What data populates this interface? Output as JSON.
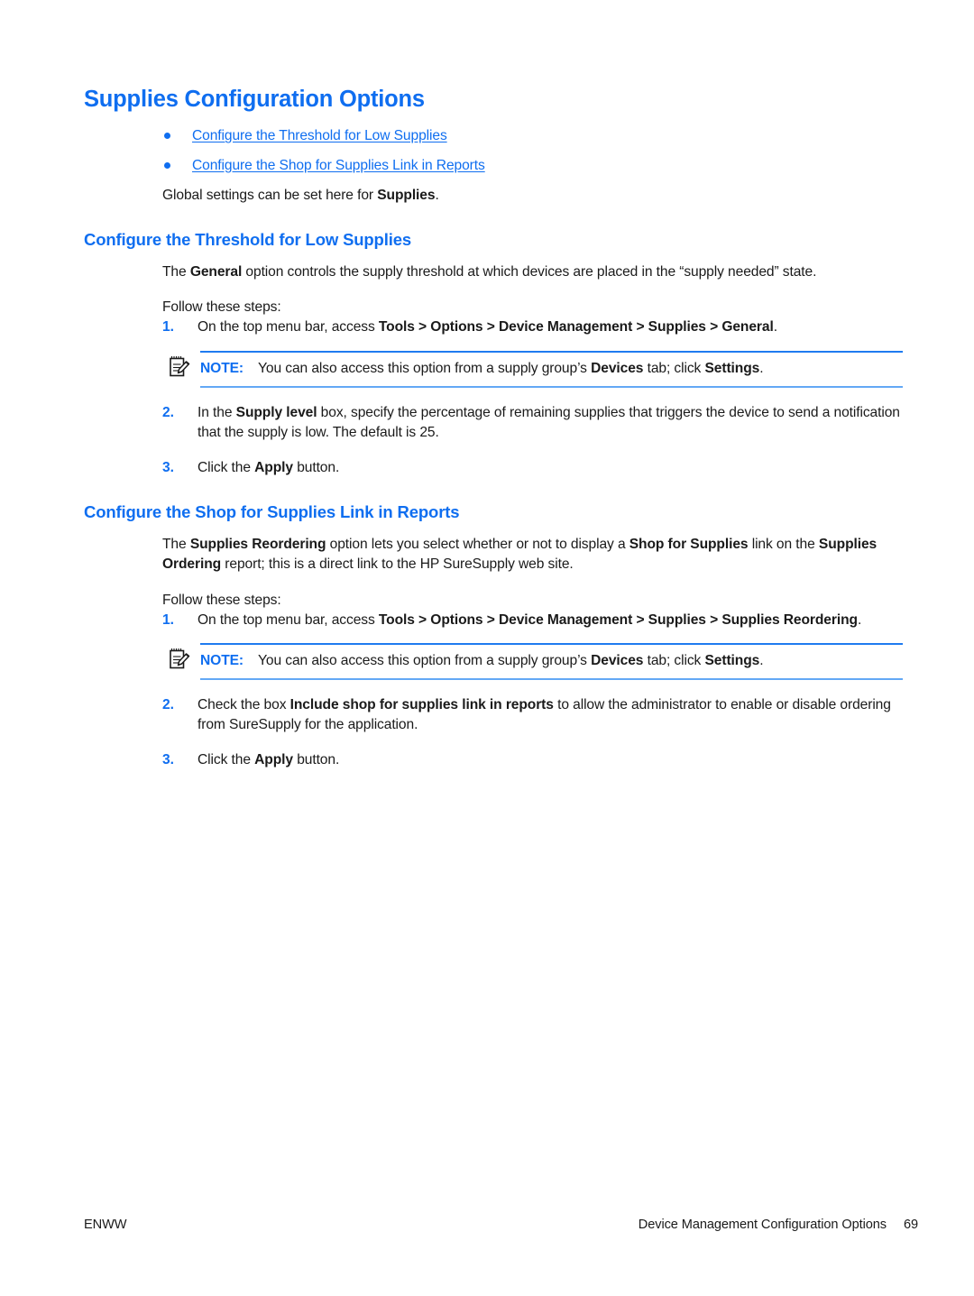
{
  "page": {
    "title": "Supplies Configuration Options"
  },
  "toc_links": [
    {
      "label": "Configure the Threshold for Low Supplies"
    },
    {
      "label": "Configure the Shop for Supplies Link in Reports"
    }
  ],
  "intro": {
    "before": "Global settings can be set here for ",
    "bold": "Supplies",
    "after": "."
  },
  "sections": [
    {
      "heading": "Configure the Threshold for Low Supplies",
      "paragraph": {
        "p1": "The ",
        "b1": "General",
        "p2": " option controls the supply threshold at which devices are placed in the “supply needed” state."
      },
      "follow": "Follow these steps:",
      "steps": [
        {
          "num": "1.",
          "p1": "On the top menu bar, access ",
          "b1": "Tools > Options > Device Management > Supplies > General",
          "p2": "."
        },
        {
          "num": "2.",
          "p1": "In the ",
          "b1": "Supply level",
          "p2": " box, specify the percentage of remaining supplies that triggers the device to send a notification that the supply is low. The default is 25."
        },
        {
          "num": "3.",
          "p1": "Click the ",
          "b1": "Apply",
          "p2": " button."
        }
      ],
      "note": {
        "label": "NOTE:",
        "t1": "You can also access this option from a supply group’s ",
        "b1": "Devices",
        "t2": " tab; click ",
        "b2": "Settings",
        "t3": "."
      }
    },
    {
      "heading": "Configure the Shop for Supplies Link in Reports",
      "paragraph": {
        "p1": "The ",
        "b1": "Supplies Reordering",
        "p2": " option lets you select whether or not to display a ",
        "b2": "Shop for Supplies",
        "p3": " link on the ",
        "b3": "Supplies Ordering",
        "p4": " report; this is a direct link to the HP SureSupply web site."
      },
      "follow": "Follow these steps:",
      "steps": [
        {
          "num": "1.",
          "p1": "On the top menu bar, access ",
          "b1": "Tools > Options > Device Management > Supplies > Supplies Reordering",
          "p2": "."
        },
        {
          "num": "2.",
          "p1": "Check the box ",
          "b1": "Include shop for supplies link in reports",
          "p2": " to allow the administrator to enable or disable ordering from SureSupply for the application."
        },
        {
          "num": "3.",
          "p1": "Click the ",
          "b1": "Apply",
          "p2": " button."
        }
      ],
      "note": {
        "label": "NOTE:",
        "t1": "You can also access this option from a supply group’s ",
        "b1": "Devices",
        "t2": " tab; click ",
        "b2": "Settings",
        "t3": "."
      }
    }
  ],
  "footer": {
    "left": "ENWW",
    "chapter": "Device Management Configuration Options",
    "page_number": "69"
  },
  "colors": {
    "heading_blue": "#0f6ef0",
    "link_blue": "#0f6ef0",
    "rule_top": "#1f7bf0",
    "rule_bottom": "#63a8f5",
    "body_text": "#1a1a1a"
  }
}
